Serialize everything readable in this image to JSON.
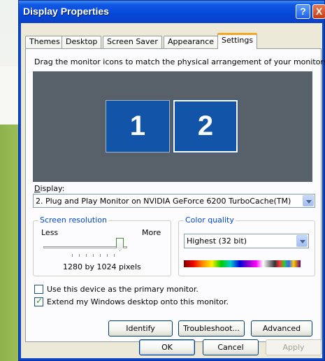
{
  "window": {
    "title": "Display Properties",
    "help_glyph": "?",
    "close_glyph": "X"
  },
  "tabs": [
    "Themes",
    "Desktop",
    "Screen Saver",
    "Appearance",
    "Settings"
  ],
  "active_tab": "Settings",
  "instructions": "Drag the monitor icons to match the physical arrangement of your monitors.",
  "monitors": [
    {
      "label": "1"
    },
    {
      "label": "2",
      "selected": true
    }
  ],
  "display": {
    "label": "Display:",
    "value": "2. Plug and Play Monitor on NVIDIA GeForce 6200 TurboCache(TM)"
  },
  "screen_resolution": {
    "title": "Screen resolution",
    "less": "Less",
    "more": "More",
    "value": "1280 by 1024 pixels",
    "level_fraction": 1.0
  },
  "color_quality": {
    "title": "Color quality",
    "value": "Highest (32 bit)"
  },
  "checkboxes": [
    {
      "label": "Use this device as the primary monitor.",
      "checked": false
    },
    {
      "label": "Extend my Windows desktop onto this monitor.",
      "checked": true
    }
  ],
  "buttons": {
    "identify": "Identify",
    "troubleshoot": "Troubleshoot...",
    "advanced": "Advanced",
    "ok": "OK",
    "cancel": "Cancel",
    "apply": "Apply"
  }
}
